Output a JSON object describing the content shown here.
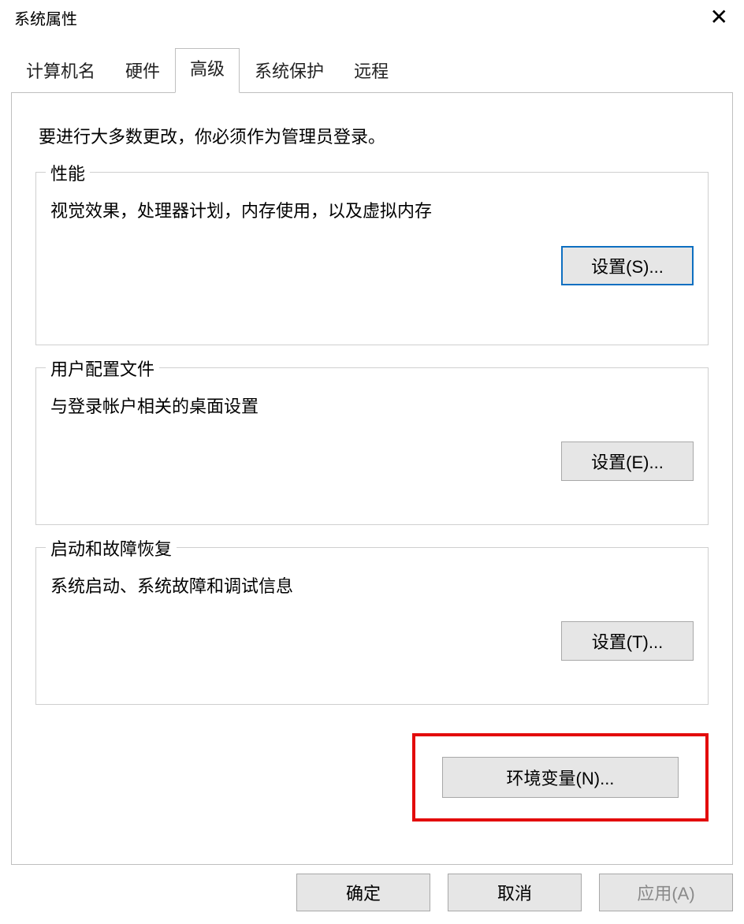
{
  "window": {
    "title": "系统属性"
  },
  "tabs": {
    "computer_name": "计算机名",
    "hardware": "硬件",
    "advanced": "高级",
    "system_protection": "系统保护",
    "remote": "远程"
  },
  "panel": {
    "admin_note": "要进行大多数更改，你必须作为管理员登录。",
    "performance": {
      "legend": "性能",
      "desc": "视觉效果，处理器计划，内存使用，以及虚拟内存",
      "button": "设置(S)..."
    },
    "profiles": {
      "legend": "用户配置文件",
      "desc": "与登录帐户相关的桌面设置",
      "button": "设置(E)..."
    },
    "startup": {
      "legend": "启动和故障恢复",
      "desc": "系统启动、系统故障和调试信息",
      "button": "设置(T)..."
    },
    "env_button": "环境变量(N)..."
  },
  "dialog": {
    "ok": "确定",
    "cancel": "取消",
    "apply": "应用(A)"
  }
}
